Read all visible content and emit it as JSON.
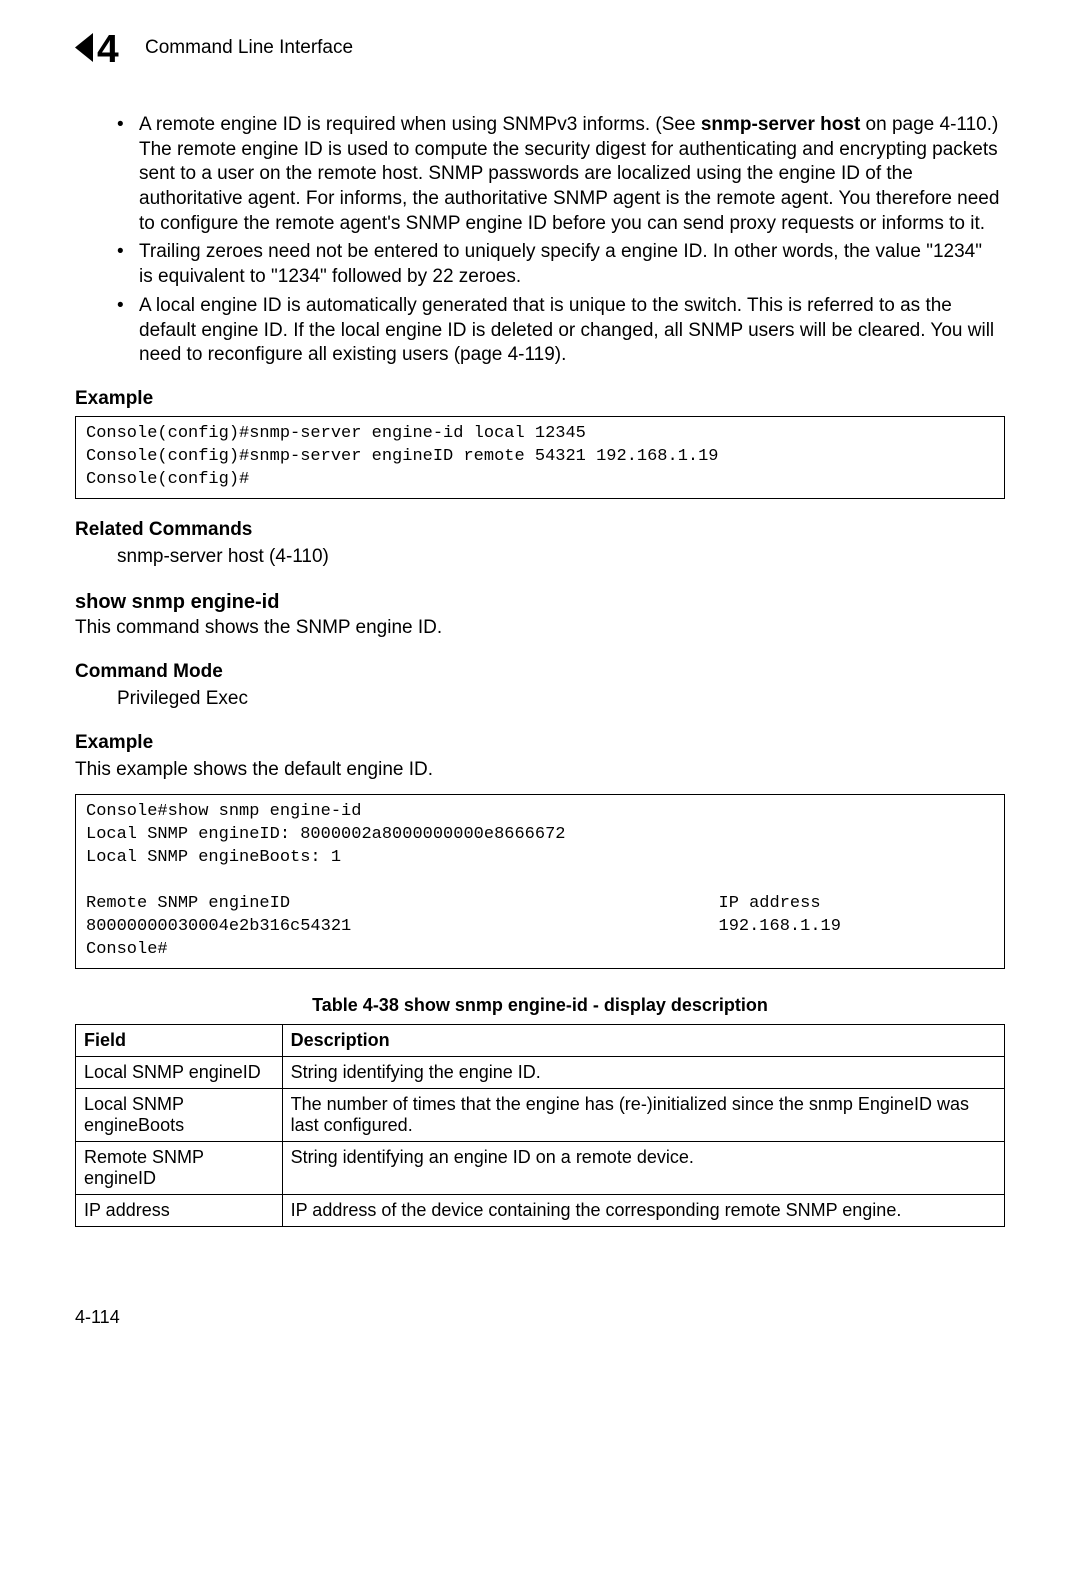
{
  "header": {
    "chapter_number": "4",
    "title": "Command Line Interface"
  },
  "bullets": [
    "A remote engine ID is required when using SNMPv3 informs. (See <b>snmp-server host</b> on page 4-110.) The remote engine ID is used to compute the security digest for authenticating and encrypting packets sent to a user on the remote host. SNMP passwords are localized using the engine ID of the authoritative agent. For informs, the authoritative SNMP agent is the remote agent. You therefore need to configure the remote agent's SNMP engine ID before you can send proxy requests or informs to it.",
    "Trailing zeroes need not be entered to uniquely specify a engine ID. In other words, the value \"1234\" is equivalent to \"1234\" followed by 22 zeroes.",
    "A local engine ID is automatically generated that is unique to the switch. This is referred to as the default engine ID. If the local engine ID is deleted or changed, all SNMP users will be cleared. You will need to reconfigure all existing users (page 4-119)."
  ],
  "sections": {
    "example1_heading": "Example",
    "example1_code": "Console(config)#snmp-server engine-id local 12345\nConsole(config)#snmp-server engineID remote 54321 192.168.1.19\nConsole(config)#",
    "related_heading": "Related Commands",
    "related_text": "snmp-server host (4-110)",
    "cmd_heading": "show snmp engine-id",
    "cmd_desc": "This command shows the SNMP engine ID.",
    "mode_heading": "Command Mode",
    "mode_text": "Privileged Exec",
    "example2_heading": "Example",
    "example2_desc": "This example shows the default engine ID.",
    "example2_code": "Console#show snmp engine-id\nLocal SNMP engineID: 8000002a8000000000e8666672\nLocal SNMP engineBoots: 1\n\nRemote SNMP engineID                                          IP address\n80000000030004e2b316c54321                                    192.168.1.19\nConsole#"
  },
  "table": {
    "caption": "Table 4-38   show snmp engine-id - display description",
    "headers": [
      "Field",
      "Description"
    ],
    "rows": [
      [
        "Local SNMP engineID",
        "String identifying the engine ID."
      ],
      [
        "Local SNMP engineBoots",
        "The number of times that the engine has (re-)initialized since the snmp EngineID was last configured."
      ],
      [
        "Remote SNMP engineID",
        "String identifying an engine ID on a remote device."
      ],
      [
        "IP address",
        "IP address of the device containing the corresponding remote SNMP engine."
      ]
    ]
  },
  "page_number": "4-114"
}
